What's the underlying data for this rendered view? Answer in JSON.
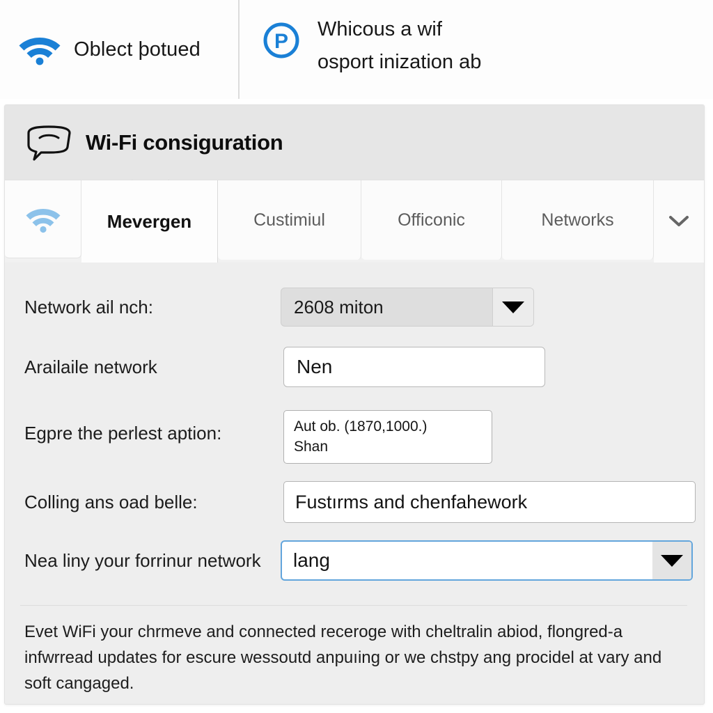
{
  "banner": {
    "left": {
      "icon": "wifi-icon",
      "label": "Oblect þotued"
    },
    "right": {
      "icon": "parking-p-circle-icon",
      "line1": "Whicous a wif",
      "line2": "osport inization ab"
    }
  },
  "panel": {
    "title_icon": "speech-bubble-icon",
    "title": "Wi-Fi consiguration",
    "tabs": [
      {
        "id": "wifi",
        "label": "",
        "icon": "wifi-icon",
        "active": false
      },
      {
        "id": "mevergen",
        "label": "Mevergen",
        "active": true
      },
      {
        "id": "custimiul",
        "label": "Custimiul",
        "active": false
      },
      {
        "id": "officonic",
        "label": "Officonic",
        "active": false
      },
      {
        "id": "networks",
        "label": "Networks",
        "active": false
      },
      {
        "id": "more",
        "label": "",
        "icon": "chevron-down-icon",
        "active": false
      }
    ],
    "form": {
      "row1": {
        "label": "Network ail nch:",
        "control": "select",
        "value": "2608 miton"
      },
      "row2": {
        "label": "Arailaile network",
        "control": "text",
        "value": "Nen"
      },
      "row3": {
        "label": "Egpre the perlest aption:",
        "control": "multiline",
        "value_line1": "Aut ob.  (1870,1000.)",
        "value_line2": "Shan"
      },
      "row4": {
        "label": "Colling ans oad belle:",
        "control": "text",
        "value": "Fustırms and chenfahework"
      },
      "row5": {
        "label": "Nea liny your forrinur network",
        "control": "select",
        "value": "lang",
        "focused": true
      }
    },
    "footnote": "Evet WiFi your chrmeve and connected receroge with cheltralin abiod, flongred-a infwrread updates for escure wessoutd anpuıing or we chstpy ang procidel at vary and soft cangaged."
  },
  "colors": {
    "accent_blue": "#1a80d6",
    "tab_icon_blue": "#8cc2ea",
    "focus_blue": "#62a5dc",
    "panel_bg": "#eeeeee",
    "titlebar_bg": "#e6e6e6"
  }
}
